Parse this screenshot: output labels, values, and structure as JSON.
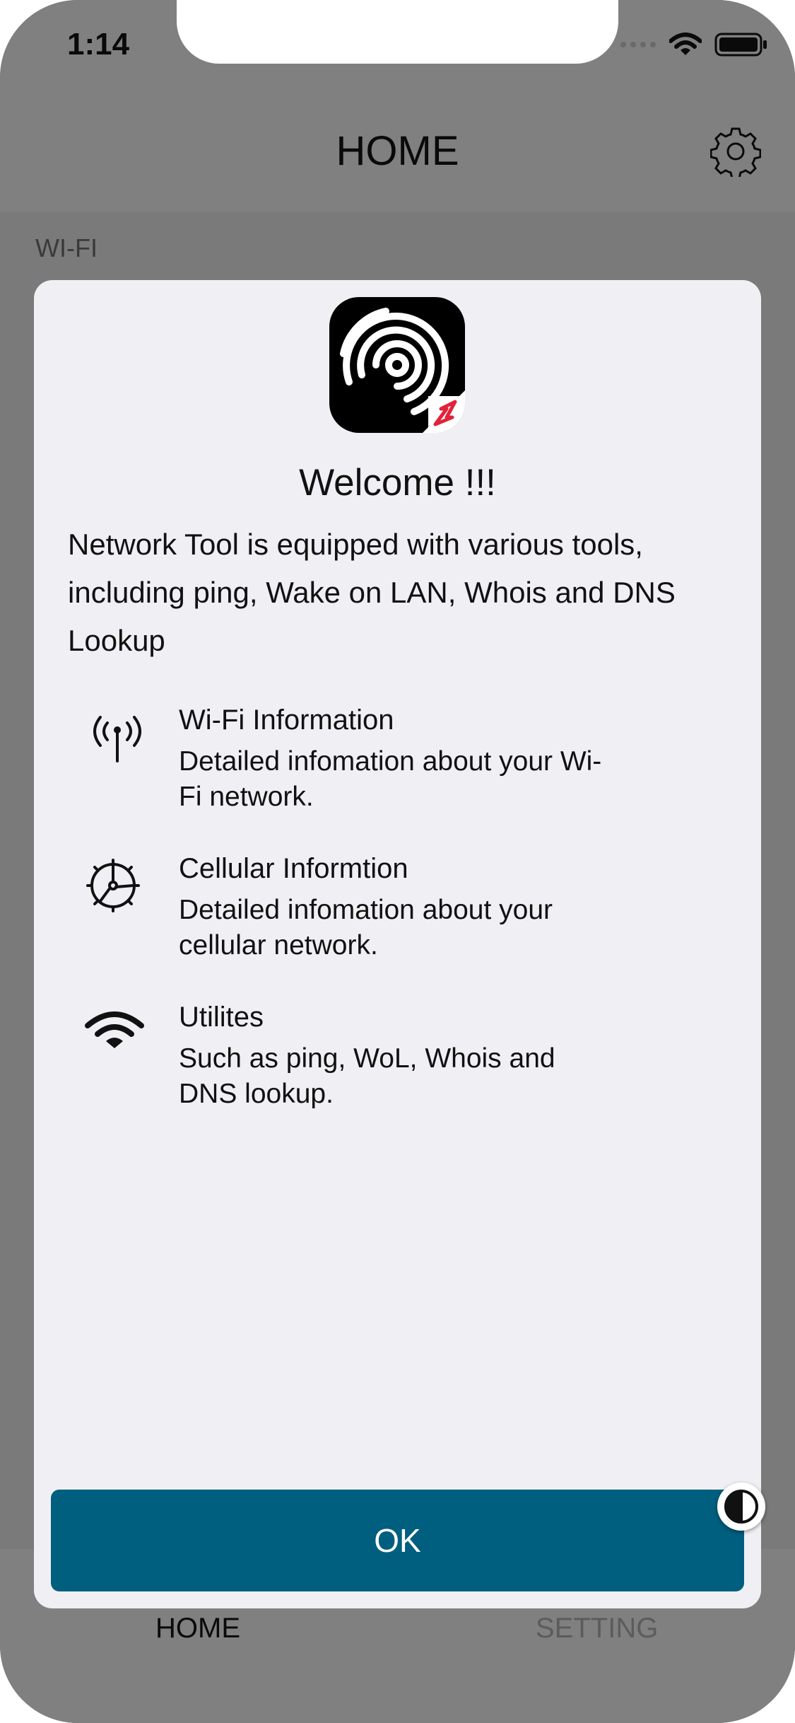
{
  "status_bar": {
    "time": "1:14"
  },
  "navbar": {
    "title": "HOME",
    "settings_icon": "gear-icon"
  },
  "background": {
    "section_label": "WI-FI"
  },
  "tab_bar": {
    "home_label": "HOME",
    "setting_label": "SETTING"
  },
  "modal": {
    "app_icon": "network-tool-logo",
    "title": "Welcome !!!",
    "intro": "Network Tool is equipped with various tools, including ping, Wake on LAN, Whois and DNS Lookup",
    "features": [
      {
        "icon": "antenna-icon",
        "title": "Wi-Fi Information",
        "desc_line1": "Detailed infomation about your Wi-",
        "desc_line2": "Fi network."
      },
      {
        "icon": "cellular-wheel-icon",
        "title": "Cellular Informtion",
        "desc_line1": "Detailed infomation about your",
        "desc_line2": "cellular network."
      },
      {
        "icon": "wifi-icon",
        "title": "Utilites",
        "desc_line1": "Such as ping, WoL, Whois and",
        "desc_line2": "DNS lookup."
      }
    ],
    "ok_label": "OK"
  },
  "colors": {
    "accent": "#005e7e",
    "modal_bg": "#f0f0f4",
    "dim": "#7b7b7b"
  }
}
